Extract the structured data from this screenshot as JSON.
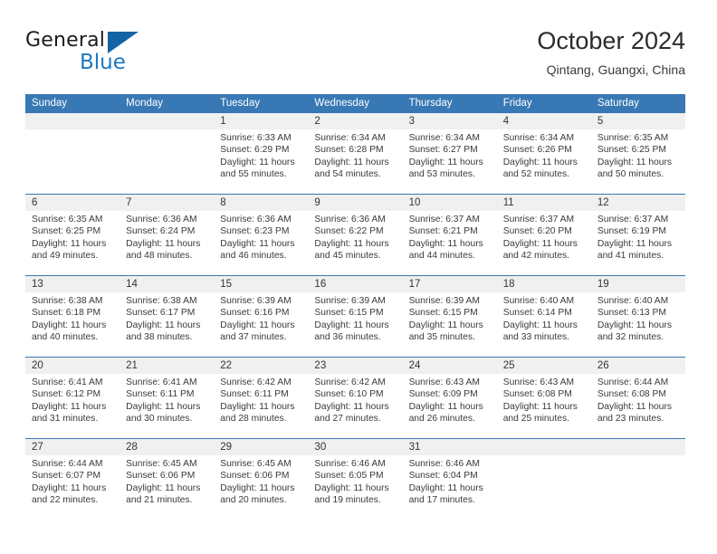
{
  "logo": {
    "name_part1": "General",
    "name_part2": "Blue",
    "triangle_color": "#1464a5",
    "blue_color": "#1c78c0"
  },
  "header": {
    "title": "October 2024",
    "subtitle": "Qintang, Guangxi, China"
  },
  "theme": {
    "header_blue": "#3878b4",
    "band_gray": "#f0f0f0",
    "text": "#3a3a3a"
  },
  "weekdays": [
    "Sunday",
    "Monday",
    "Tuesday",
    "Wednesday",
    "Thursday",
    "Friday",
    "Saturday"
  ],
  "weeks": [
    [
      {
        "day": "",
        "lines": []
      },
      {
        "day": "",
        "lines": []
      },
      {
        "day": "1",
        "lines": [
          "Sunrise: 6:33 AM",
          "Sunset: 6:29 PM",
          "Daylight: 11 hours",
          "and 55 minutes."
        ]
      },
      {
        "day": "2",
        "lines": [
          "Sunrise: 6:34 AM",
          "Sunset: 6:28 PM",
          "Daylight: 11 hours",
          "and 54 minutes."
        ]
      },
      {
        "day": "3",
        "lines": [
          "Sunrise: 6:34 AM",
          "Sunset: 6:27 PM",
          "Daylight: 11 hours",
          "and 53 minutes."
        ]
      },
      {
        "day": "4",
        "lines": [
          "Sunrise: 6:34 AM",
          "Sunset: 6:26 PM",
          "Daylight: 11 hours",
          "and 52 minutes."
        ]
      },
      {
        "day": "5",
        "lines": [
          "Sunrise: 6:35 AM",
          "Sunset: 6:25 PM",
          "Daylight: 11 hours",
          "and 50 minutes."
        ]
      }
    ],
    [
      {
        "day": "6",
        "lines": [
          "Sunrise: 6:35 AM",
          "Sunset: 6:25 PM",
          "Daylight: 11 hours",
          "and 49 minutes."
        ]
      },
      {
        "day": "7",
        "lines": [
          "Sunrise: 6:36 AM",
          "Sunset: 6:24 PM",
          "Daylight: 11 hours",
          "and 48 minutes."
        ]
      },
      {
        "day": "8",
        "lines": [
          "Sunrise: 6:36 AM",
          "Sunset: 6:23 PM",
          "Daylight: 11 hours",
          "and 46 minutes."
        ]
      },
      {
        "day": "9",
        "lines": [
          "Sunrise: 6:36 AM",
          "Sunset: 6:22 PM",
          "Daylight: 11 hours",
          "and 45 minutes."
        ]
      },
      {
        "day": "10",
        "lines": [
          "Sunrise: 6:37 AM",
          "Sunset: 6:21 PM",
          "Daylight: 11 hours",
          "and 44 minutes."
        ]
      },
      {
        "day": "11",
        "lines": [
          "Sunrise: 6:37 AM",
          "Sunset: 6:20 PM",
          "Daylight: 11 hours",
          "and 42 minutes."
        ]
      },
      {
        "day": "12",
        "lines": [
          "Sunrise: 6:37 AM",
          "Sunset: 6:19 PM",
          "Daylight: 11 hours",
          "and 41 minutes."
        ]
      }
    ],
    [
      {
        "day": "13",
        "lines": [
          "Sunrise: 6:38 AM",
          "Sunset: 6:18 PM",
          "Daylight: 11 hours",
          "and 40 minutes."
        ]
      },
      {
        "day": "14",
        "lines": [
          "Sunrise: 6:38 AM",
          "Sunset: 6:17 PM",
          "Daylight: 11 hours",
          "and 38 minutes."
        ]
      },
      {
        "day": "15",
        "lines": [
          "Sunrise: 6:39 AM",
          "Sunset: 6:16 PM",
          "Daylight: 11 hours",
          "and 37 minutes."
        ]
      },
      {
        "day": "16",
        "lines": [
          "Sunrise: 6:39 AM",
          "Sunset: 6:15 PM",
          "Daylight: 11 hours",
          "and 36 minutes."
        ]
      },
      {
        "day": "17",
        "lines": [
          "Sunrise: 6:39 AM",
          "Sunset: 6:15 PM",
          "Daylight: 11 hours",
          "and 35 minutes."
        ]
      },
      {
        "day": "18",
        "lines": [
          "Sunrise: 6:40 AM",
          "Sunset: 6:14 PM",
          "Daylight: 11 hours",
          "and 33 minutes."
        ]
      },
      {
        "day": "19",
        "lines": [
          "Sunrise: 6:40 AM",
          "Sunset: 6:13 PM",
          "Daylight: 11 hours",
          "and 32 minutes."
        ]
      }
    ],
    [
      {
        "day": "20",
        "lines": [
          "Sunrise: 6:41 AM",
          "Sunset: 6:12 PM",
          "Daylight: 11 hours",
          "and 31 minutes."
        ]
      },
      {
        "day": "21",
        "lines": [
          "Sunrise: 6:41 AM",
          "Sunset: 6:11 PM",
          "Daylight: 11 hours",
          "and 30 minutes."
        ]
      },
      {
        "day": "22",
        "lines": [
          "Sunrise: 6:42 AM",
          "Sunset: 6:11 PM",
          "Daylight: 11 hours",
          "and 28 minutes."
        ]
      },
      {
        "day": "23",
        "lines": [
          "Sunrise: 6:42 AM",
          "Sunset: 6:10 PM",
          "Daylight: 11 hours",
          "and 27 minutes."
        ]
      },
      {
        "day": "24",
        "lines": [
          "Sunrise: 6:43 AM",
          "Sunset: 6:09 PM",
          "Daylight: 11 hours",
          "and 26 minutes."
        ]
      },
      {
        "day": "25",
        "lines": [
          "Sunrise: 6:43 AM",
          "Sunset: 6:08 PM",
          "Daylight: 11 hours",
          "and 25 minutes."
        ]
      },
      {
        "day": "26",
        "lines": [
          "Sunrise: 6:44 AM",
          "Sunset: 6:08 PM",
          "Daylight: 11 hours",
          "and 23 minutes."
        ]
      }
    ],
    [
      {
        "day": "27",
        "lines": [
          "Sunrise: 6:44 AM",
          "Sunset: 6:07 PM",
          "Daylight: 11 hours",
          "and 22 minutes."
        ]
      },
      {
        "day": "28",
        "lines": [
          "Sunrise: 6:45 AM",
          "Sunset: 6:06 PM",
          "Daylight: 11 hours",
          "and 21 minutes."
        ]
      },
      {
        "day": "29",
        "lines": [
          "Sunrise: 6:45 AM",
          "Sunset: 6:06 PM",
          "Daylight: 11 hours",
          "and 20 minutes."
        ]
      },
      {
        "day": "30",
        "lines": [
          "Sunrise: 6:46 AM",
          "Sunset: 6:05 PM",
          "Daylight: 11 hours",
          "and 19 minutes."
        ]
      },
      {
        "day": "31",
        "lines": [
          "Sunrise: 6:46 AM",
          "Sunset: 6:04 PM",
          "Daylight: 11 hours",
          "and 17 minutes."
        ]
      },
      {
        "day": "",
        "lines": []
      },
      {
        "day": "",
        "lines": []
      }
    ]
  ]
}
